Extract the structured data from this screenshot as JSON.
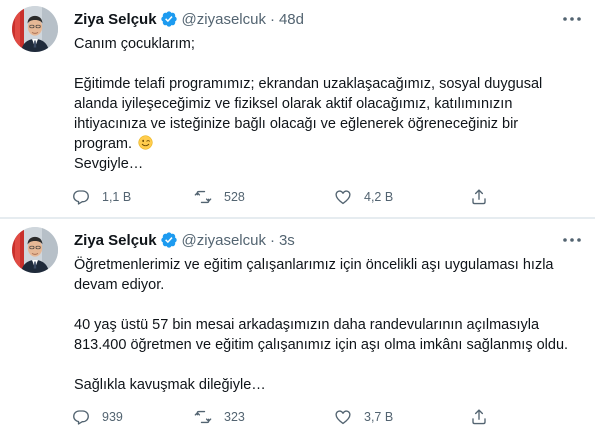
{
  "tweets": [
    {
      "author": {
        "name": "Ziya Selçuk",
        "handle": "@ziyaselcuk",
        "separator": "·",
        "time": "48d"
      },
      "icons": {
        "verified": "verified-badge-icon",
        "more": "more-icon"
      },
      "lines": [
        "Canım çocuklarım;",
        "",
        "Eğitimde telafi programımız; ekrandan uzaklaşacağımız, sosyal duygusal",
        "alanda iyileşeceğimiz ve fiziksel olarak aktif olacağımız, katılımınızın",
        "ihtiyacınıza ve isteğinize bağlı olacağı ve eğlenerek öğreneceğiniz bir",
        "program.",
        "Sevgiyle…"
      ],
      "emoji": "winking-face-emoji",
      "stats": {
        "replies": "1,1 B",
        "retweets": "528",
        "likes": "4,2 B"
      }
    },
    {
      "author": {
        "name": "Ziya Selçuk",
        "handle": "@ziyaselcuk",
        "separator": "·",
        "time": "3s"
      },
      "icons": {
        "verified": "verified-badge-icon",
        "more": "more-icon"
      },
      "lines": [
        "Öğretmenlerimiz ve eğitim çalışanlarımız için öncelikli aşı uygulaması hızla",
        "devam ediyor.",
        "",
        "40 yaş üstü 57 bin mesai arkadaşımızın daha randevularının açılmasıyla",
        "813.400 öğretmen ve eğitim çalışanımız için aşı olma imkânı sağlanmış oldu.",
        "",
        "Sağlıkla kavuşmak dileğiyle…"
      ],
      "stats": {
        "replies": "939",
        "retweets": "323",
        "likes": "3,7 B"
      }
    }
  ],
  "colors": {
    "text": "#0f1419",
    "muted": "#536471",
    "verified": "#1d9bf0",
    "divider": "#e6ecf0"
  }
}
